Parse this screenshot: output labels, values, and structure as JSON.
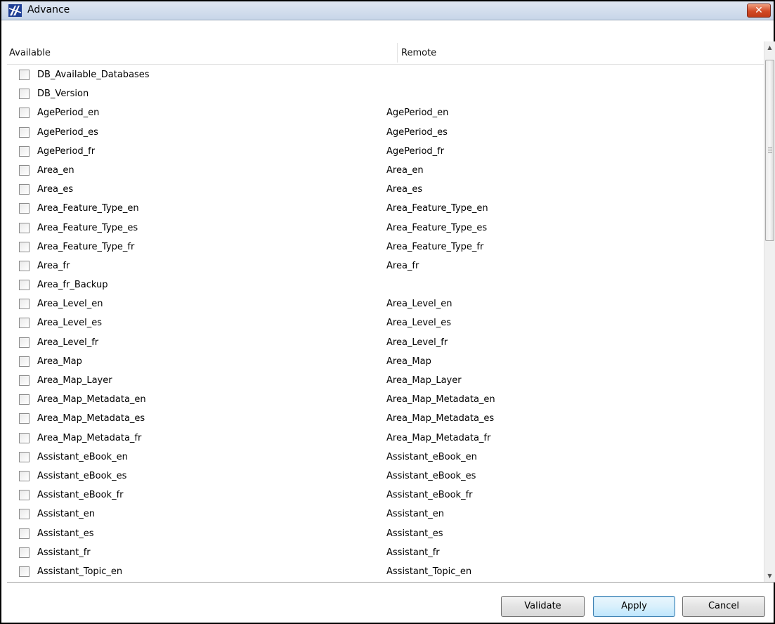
{
  "window": {
    "title": "Advance",
    "close_glyph": "✕"
  },
  "table": {
    "columns": {
      "available": "Available",
      "remote": "Remote"
    },
    "rows": [
      {
        "available": "DB_Available_Databases",
        "remote": "",
        "checked": false
      },
      {
        "available": "DB_Version",
        "remote": "",
        "checked": false
      },
      {
        "available": "AgePeriod_en",
        "remote": "AgePeriod_en",
        "checked": false
      },
      {
        "available": "AgePeriod_es",
        "remote": "AgePeriod_es",
        "checked": false
      },
      {
        "available": "AgePeriod_fr",
        "remote": "AgePeriod_fr",
        "checked": false
      },
      {
        "available": "Area_en",
        "remote": "Area_en",
        "checked": false
      },
      {
        "available": "Area_es",
        "remote": "Area_es",
        "checked": false
      },
      {
        "available": "Area_Feature_Type_en",
        "remote": "Area_Feature_Type_en",
        "checked": false
      },
      {
        "available": "Area_Feature_Type_es",
        "remote": "Area_Feature_Type_es",
        "checked": false
      },
      {
        "available": "Area_Feature_Type_fr",
        "remote": "Area_Feature_Type_fr",
        "checked": false
      },
      {
        "available": "Area_fr",
        "remote": "Area_fr",
        "checked": false
      },
      {
        "available": "Area_fr_Backup",
        "remote": "",
        "checked": false
      },
      {
        "available": "Area_Level_en",
        "remote": "Area_Level_en",
        "checked": false
      },
      {
        "available": "Area_Level_es",
        "remote": "Area_Level_es",
        "checked": false
      },
      {
        "available": "Area_Level_fr",
        "remote": "Area_Level_fr",
        "checked": false
      },
      {
        "available": "Area_Map",
        "remote": "Area_Map",
        "checked": false
      },
      {
        "available": "Area_Map_Layer",
        "remote": "Area_Map_Layer",
        "checked": false
      },
      {
        "available": "Area_Map_Metadata_en",
        "remote": "Area_Map_Metadata_en",
        "checked": false
      },
      {
        "available": "Area_Map_Metadata_es",
        "remote": "Area_Map_Metadata_es",
        "checked": false
      },
      {
        "available": "Area_Map_Metadata_fr",
        "remote": "Area_Map_Metadata_fr",
        "checked": false
      },
      {
        "available": "Assistant_eBook_en",
        "remote": "Assistant_eBook_en",
        "checked": false
      },
      {
        "available": "Assistant_eBook_es",
        "remote": "Assistant_eBook_es",
        "checked": false
      },
      {
        "available": "Assistant_eBook_fr",
        "remote": "Assistant_eBook_fr",
        "checked": false
      },
      {
        "available": "Assistant_en",
        "remote": "Assistant_en",
        "checked": false
      },
      {
        "available": "Assistant_es",
        "remote": "Assistant_es",
        "checked": false
      },
      {
        "available": "Assistant_fr",
        "remote": "Assistant_fr",
        "checked": false
      },
      {
        "available": "Assistant_Topic_en",
        "remote": "Assistant_Topic_en",
        "checked": false
      }
    ]
  },
  "scrollbar": {
    "up_glyph": "▲",
    "down_glyph": "▼"
  },
  "buttons": {
    "validate": "Validate",
    "apply": "Apply",
    "cancel": "Cancel"
  },
  "icons": {
    "app": "app-logo-icon",
    "close": "close-icon",
    "checkbox": "checkbox-unchecked"
  },
  "colors": {
    "titlebar": "#c7d5e8",
    "close_button": "#d24a26",
    "default_button_border": "#3c7fb1"
  }
}
